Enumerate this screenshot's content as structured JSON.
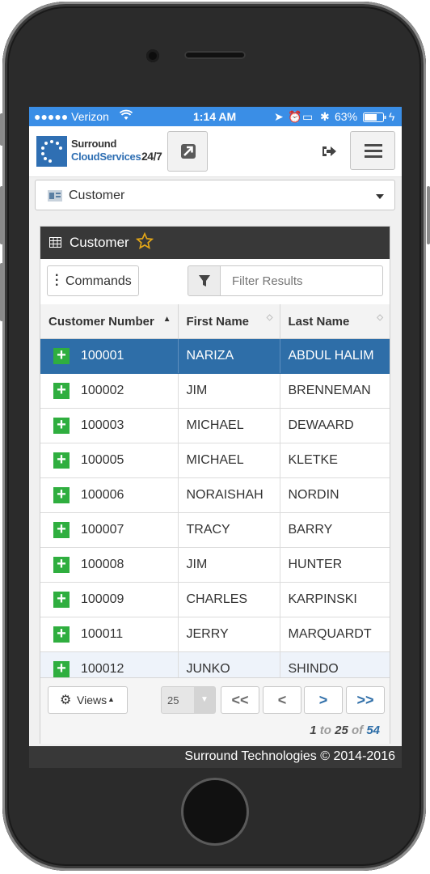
{
  "status_bar": {
    "carrier": "●●●●● Verizon",
    "time": "1:14 AM",
    "battery": "63%"
  },
  "header": {
    "logo_line1": "Surround",
    "logo_line2": "CloudServices",
    "logo_suffix": "24/7"
  },
  "module_select": {
    "value": "Customer"
  },
  "panel": {
    "title": "Customer",
    "commands_label": "Commands",
    "filter_placeholder": "Filter Results"
  },
  "table": {
    "columns": [
      "Customer Number",
      "First Name",
      "Last Name"
    ],
    "rows": [
      {
        "number": "100001",
        "first": "NARIZA",
        "last": "ABDUL HALIM"
      },
      {
        "number": "100002",
        "first": "JIM",
        "last": "BRENNEMAN"
      },
      {
        "number": "100003",
        "first": "MICHAEL",
        "last": "DEWAARD"
      },
      {
        "number": "100005",
        "first": "MICHAEL",
        "last": "KLETKE"
      },
      {
        "number": "100006",
        "first": "NORAISHAH",
        "last": "NORDIN"
      },
      {
        "number": "100007",
        "first": "TRACY",
        "last": "BARRY"
      },
      {
        "number": "100008",
        "first": "JIM",
        "last": "HUNTER"
      },
      {
        "number": "100009",
        "first": "CHARLES",
        "last": "KARPINSKI"
      },
      {
        "number": "100011",
        "first": "JERRY",
        "last": "MARQUARDT"
      },
      {
        "number": "100012",
        "first": "JUNKO",
        "last": "SHINDO"
      }
    ]
  },
  "pager": {
    "views_label": "Views",
    "page_size": "25",
    "first": "<<",
    "prev": "<",
    "next": ">",
    "last": ">>",
    "range_from": "1",
    "range_to_word": "to",
    "range_to": "25",
    "range_of_word": "of",
    "range_total": "54"
  },
  "footer": {
    "text": "Surround Technologies © 2014-2016"
  },
  "colors": {
    "status_bar": "#3a8ee6",
    "selected_row": "#2e6ea8",
    "panel_header": "#383838",
    "add_icon": "#2fae3f",
    "star": "#e6a817"
  }
}
